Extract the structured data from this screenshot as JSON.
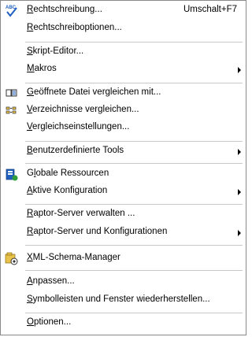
{
  "menu": {
    "items": [
      {
        "label": "Rechtschreibung...",
        "shortcut": "Umschalt+F7",
        "icon": "spellcheck-icon",
        "access_key": "R"
      },
      {
        "label": "Rechtschreiboptionen...",
        "access_key": "R"
      },
      {
        "label": "Skript-Editor...",
        "access_key": "S"
      },
      {
        "label": "Makros",
        "access_key": "M",
        "submenu": true
      },
      {
        "label": "Geöffnete Datei vergleichen mit...",
        "icon": "compare-file-icon",
        "access_key": "G"
      },
      {
        "label": "Verzeichnisse vergleichen...",
        "icon": "compare-directories-icon",
        "access_key": "V"
      },
      {
        "label": "Vergleichseinstellungen...",
        "access_key": "V"
      },
      {
        "label": "Benutzerdefinierte Tools",
        "access_key": "B",
        "submenu": true
      },
      {
        "label": "Globale Ressourcen",
        "icon": "global-resources-icon",
        "access_key": "l"
      },
      {
        "label": "Aktive Konfiguration",
        "access_key": "A",
        "submenu": true
      },
      {
        "label": "Raptor-Server verwalten ...",
        "access_key": "R"
      },
      {
        "label": "Raptor-Server und Konfigurationen",
        "access_key": "R",
        "submenu": true
      },
      {
        "label": "XML-Schema-Manager",
        "icon": "schema-manager-icon",
        "access_key": "X"
      },
      {
        "label": "Anpassen...",
        "access_key": "A"
      },
      {
        "label": "Symbolleisten und Fenster wiederherstellen...",
        "access_key": "S"
      },
      {
        "label": "Optionen...",
        "access_key": "O"
      }
    ]
  },
  "colors": {
    "border": "#8a8a8a",
    "separator": "#c8c8c8",
    "text": "#000000",
    "icon_blue": "#1f5fbf",
    "icon_green": "#2e9e3a",
    "icon_yellow": "#e8c24a"
  }
}
